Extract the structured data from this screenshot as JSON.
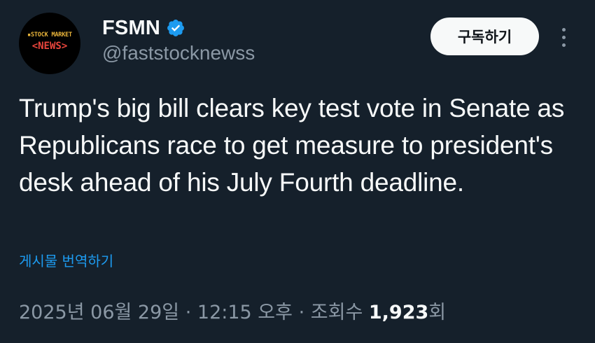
{
  "author": {
    "display_name": "FSMN",
    "handle": "@faststocknewss",
    "verified": true,
    "avatar": {
      "top_text": "STOCK MARKET",
      "main_text": "<NEWS>",
      "top_color": "#e9b43a",
      "main_color": "#e8453c"
    }
  },
  "header": {
    "subscribe_label": "구독하기",
    "more_icon": "more-vertical-icon"
  },
  "tweet": {
    "text": "Trump's big bill clears key test vote in Senate as Republicans race to get measure to president's desk ahead of his July Fourth deadline.",
    "translate_label": "게시물 번역하기"
  },
  "meta": {
    "date": "2025년 06월 29일",
    "separator": "·",
    "time": "12:15 오후",
    "views_label": "조회수",
    "views_count": "1,923",
    "views_suffix": "회"
  },
  "colors": {
    "background": "#15202b",
    "accent": "#1d9bf0",
    "secondary_text": "#8b98a5",
    "primary_text": "#f7f9f9"
  }
}
